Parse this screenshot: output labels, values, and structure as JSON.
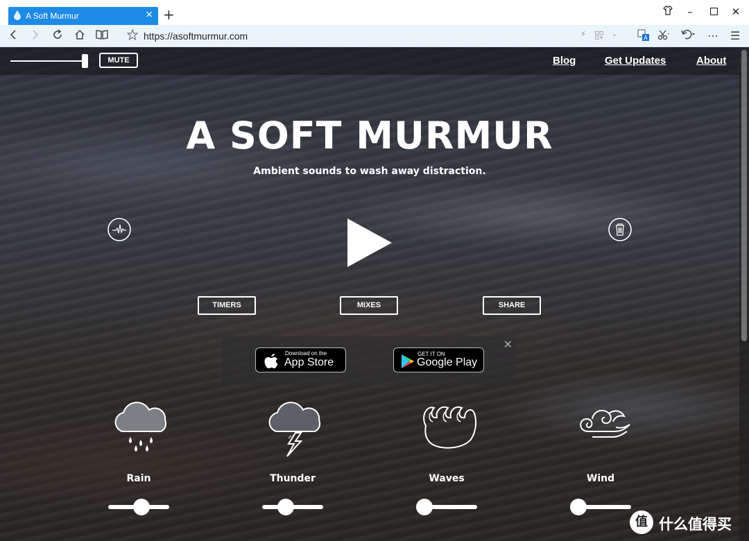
{
  "browser": {
    "tab_title": "A Soft Murmur",
    "new_tab_icon": "plus-icon",
    "url": "https://asoftmurmur.com",
    "window_controls": [
      "shirt-icon",
      "minimize-icon",
      "maximize-icon",
      "close-icon"
    ],
    "accent_color": "#1d8ae6"
  },
  "nav": {
    "mute_label": "MUTE",
    "links": [
      "Blog",
      "Get Updates",
      "About"
    ]
  },
  "hero": {
    "title": "A SOFT MURMUR",
    "subtitle": "Ambient sounds to wash away distraction."
  },
  "actions": {
    "timers": "TIMERS",
    "mixes": "MIXES",
    "share": "SHARE"
  },
  "app_banner": {
    "close_glyph": "✕",
    "apple_small": "Download on the",
    "apple_big": "App Store",
    "google_small": "GET IT ON",
    "google_big": "Google Play"
  },
  "sounds": [
    {
      "name": "Rain",
      "icon": "rain-cloud-icon",
      "volume": 0.57
    },
    {
      "name": "Thunder",
      "icon": "thunder-cloud-icon",
      "volume": 0.35
    },
    {
      "name": "Waves",
      "icon": "waves-icon",
      "volume": 0.0
    },
    {
      "name": "Wind",
      "icon": "wind-icon",
      "volume": 0.0
    }
  ],
  "watermark": {
    "glyph": "值",
    "text": "什么值得买"
  }
}
